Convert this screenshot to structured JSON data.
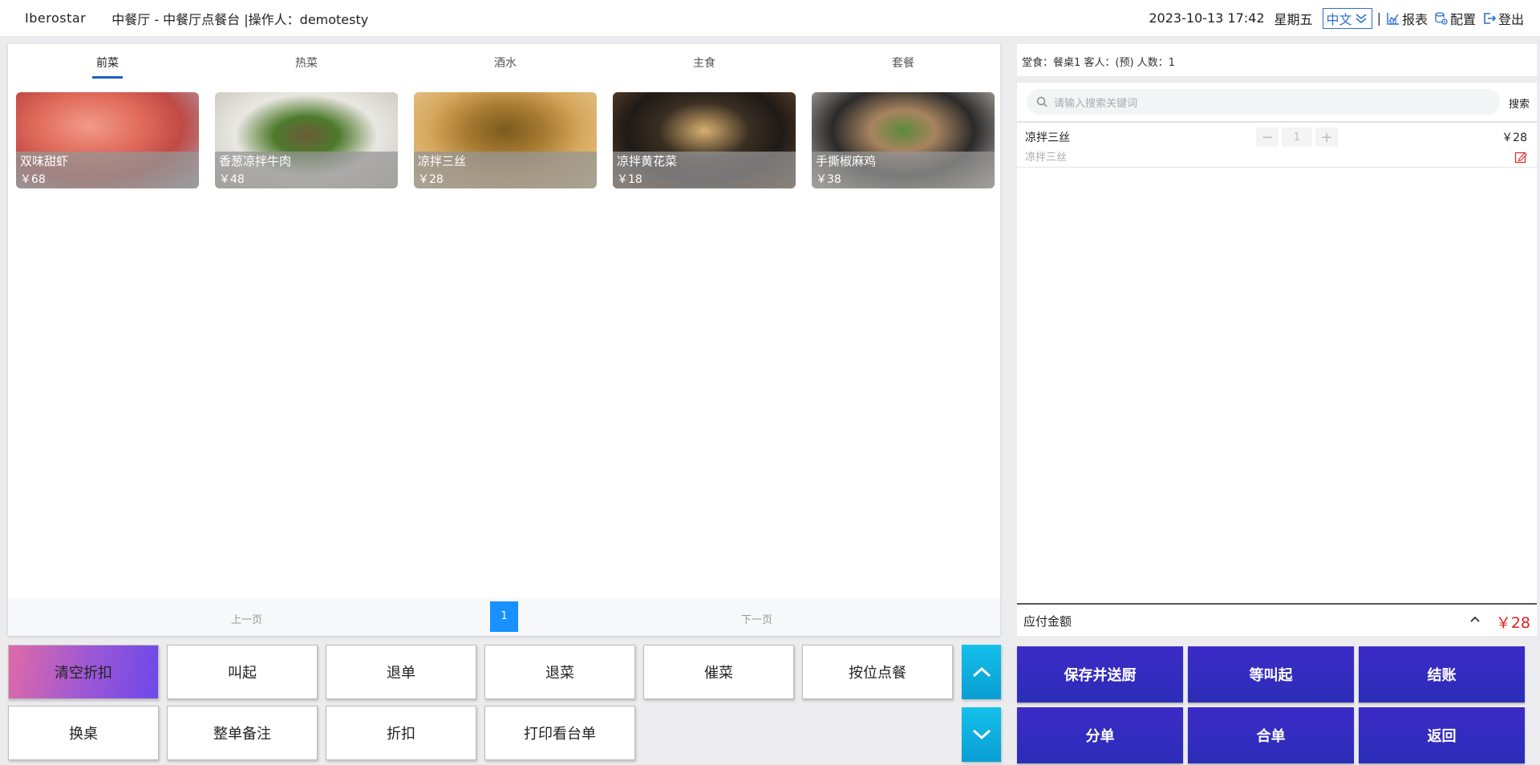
{
  "header": {
    "brand": "Iberostar",
    "title": "中餐厅 - 中餐厅点餐台 |操作人：demotesty",
    "datetime": "2023-10-13 17:42",
    "weekday": "星期五",
    "language": "中文",
    "separator": "|",
    "report_label": "报表",
    "config_label": "配置",
    "logout_label": "登出"
  },
  "tabs": [
    {
      "label": "前菜"
    },
    {
      "label": "热菜"
    },
    {
      "label": "酒水"
    },
    {
      "label": "主食"
    },
    {
      "label": "套餐"
    }
  ],
  "dishes": [
    {
      "name": "双味甜虾",
      "price": "￥68"
    },
    {
      "name": "香葱凉拌牛肉",
      "price": "￥48"
    },
    {
      "name": "凉拌三丝",
      "price": "￥28"
    },
    {
      "name": "凉拌黄花菜",
      "price": "￥18"
    },
    {
      "name": "手撕椒麻鸡",
      "price": "￥38"
    }
  ],
  "pager": {
    "prev": "上一页",
    "page": "1",
    "next": "下一页"
  },
  "actions": {
    "row1": [
      "清空折扣",
      "叫起",
      "退单",
      "退菜",
      "催菜",
      "按位点餐"
    ],
    "row2": [
      "换桌",
      "整单备注",
      "折扣",
      "打印看台单"
    ]
  },
  "order": {
    "info": "堂食：餐桌1 客人：(预) 人数：1",
    "search_placeholder": "请输入搜索关键词",
    "search_button": "搜索",
    "items": [
      {
        "name": "凉拌三丝",
        "note": "凉拌三丝",
        "qty": "1",
        "price": "￥28"
      }
    ],
    "total_label": "应付金额",
    "total": "￥28"
  },
  "bottom_buttons": {
    "row1": [
      "保存并送厨",
      "等叫起",
      "结账"
    ],
    "row2": [
      "分单",
      "合单",
      "返回"
    ]
  },
  "colors": {
    "accent_blue": "#1a5fc8",
    "page_button": "#1890ff",
    "primary_button": "#3c2bc7",
    "scroll_button": "#14c0ea",
    "total_red": "#e02020"
  },
  "icons": {
    "language_toggle": "chevron-double-down-icon",
    "report": "chart-icon",
    "config": "config-icon",
    "logout": "logout-icon",
    "search": "search-icon",
    "edit": "edit-icon",
    "scroll_up": "chevron-up-icon",
    "scroll_down": "chevron-down-icon"
  }
}
